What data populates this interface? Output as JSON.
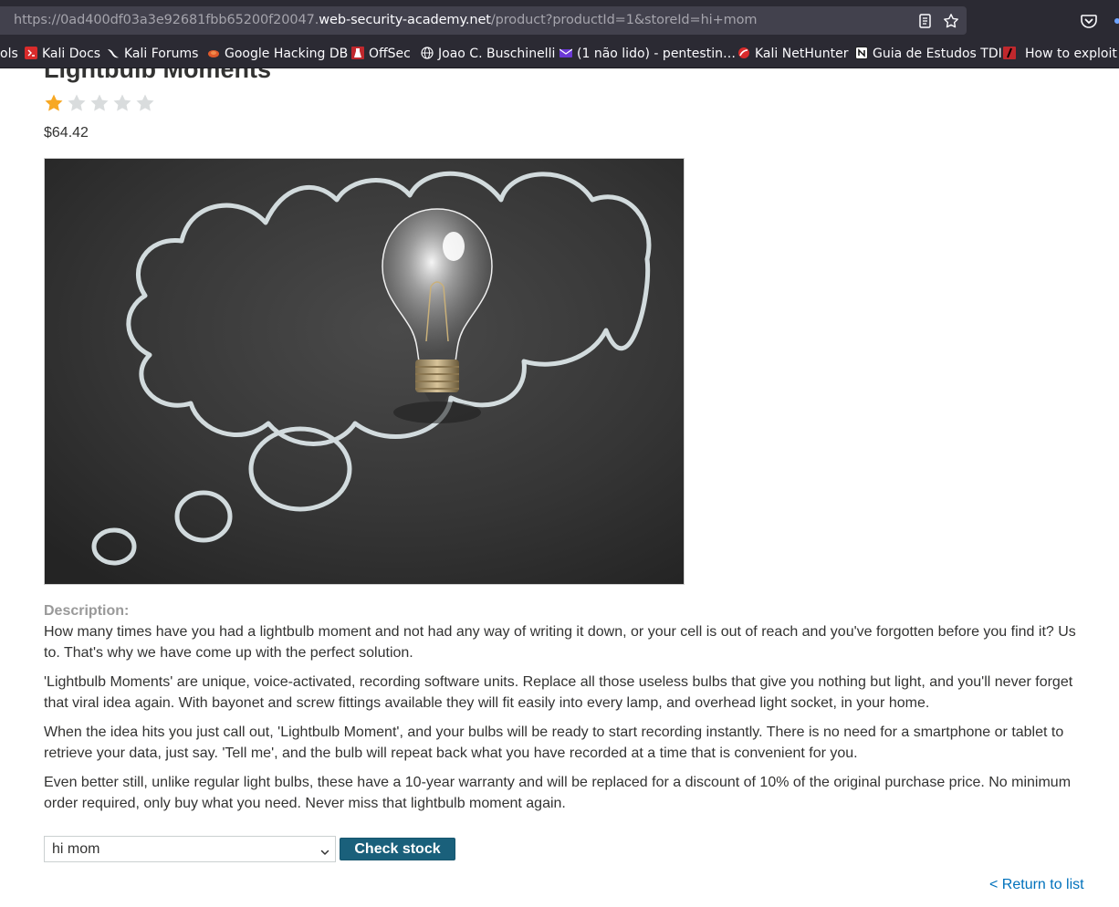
{
  "browser": {
    "url": {
      "prefix": "https://0ad400df03a3e92681fbb65200f20047.",
      "host": "web-security-academy.net",
      "path": "/product?productId=1&storeId=hi+mom"
    },
    "bookmarks": [
      {
        "label": "ols",
        "icon": "none"
      },
      {
        "label": "Kali Docs",
        "icon": "kali-docs-icon",
        "color": "#d92b2b"
      },
      {
        "label": "Kali Forums",
        "icon": "kali-dragon-icon",
        "color": "#ffffff"
      },
      {
        "label": "Google Hacking DB",
        "icon": "ghdb-icon",
        "color": "#e05a2b"
      },
      {
        "label": "OffSec",
        "icon": "offsec-icon",
        "color": "#c0282d"
      },
      {
        "label": "Joao C. Buschinelli",
        "icon": "globe-icon",
        "color": "#fbfbfe"
      },
      {
        "label": "(1 não lido) - pentestin…",
        "icon": "mail-icon",
        "color": "#6b39d6"
      },
      {
        "label": "Kali NetHunter",
        "icon": "nethunter-icon",
        "color": "#d92b2b"
      },
      {
        "label": "Guia de Estudos TDI",
        "icon": "notion-icon",
        "color": "#ffffff"
      },
      {
        "label": "How to exploit C",
        "icon": "exploit-icon",
        "color": "#c0282d"
      }
    ]
  },
  "product": {
    "title": "Lightbulb Moments",
    "rating": 1,
    "rating_max": 5,
    "price": "$64.42",
    "description_heading": "Description:",
    "description": [
      "How many times have you had a lightbulb moment and not had any way of writing it down, or your cell is out of reach and you've forgotten before you find it? Us to. That's why we have come up with the perfect solution.",
      "'Lightbulb Moments' are unique, voice-activated, recording software units. Replace all those useless bulbs that give you nothing but light, and you'll never forget that viral idea again. With bayonet and screw fittings available they will fit easily into every lamp, and overhead light socket, in your home.",
      "When the idea hits you just call out, 'Lightbulb Moment', and your bulbs will be ready to start recording instantly. There is no need for a smartphone or tablet to retrieve your data, just say. 'Tell me', and the bulb will repeat back what you have recorded at a time that is convenient for you.",
      "Even better still, unlike regular light bulbs, these have a 10-year warranty and will be replaced for a discount of 10% of the original purchase price. No minimum order required, only buy what you need. Never miss that lightbulb moment again."
    ]
  },
  "stock": {
    "selected_store": "hi mom",
    "button_label": "Check stock"
  },
  "navigation": {
    "return_label": "< Return to list"
  },
  "colors": {
    "star_filled": "#f7a823",
    "star_empty": "#d9dcdd",
    "button": "#1a607b",
    "link": "#0071bc"
  }
}
